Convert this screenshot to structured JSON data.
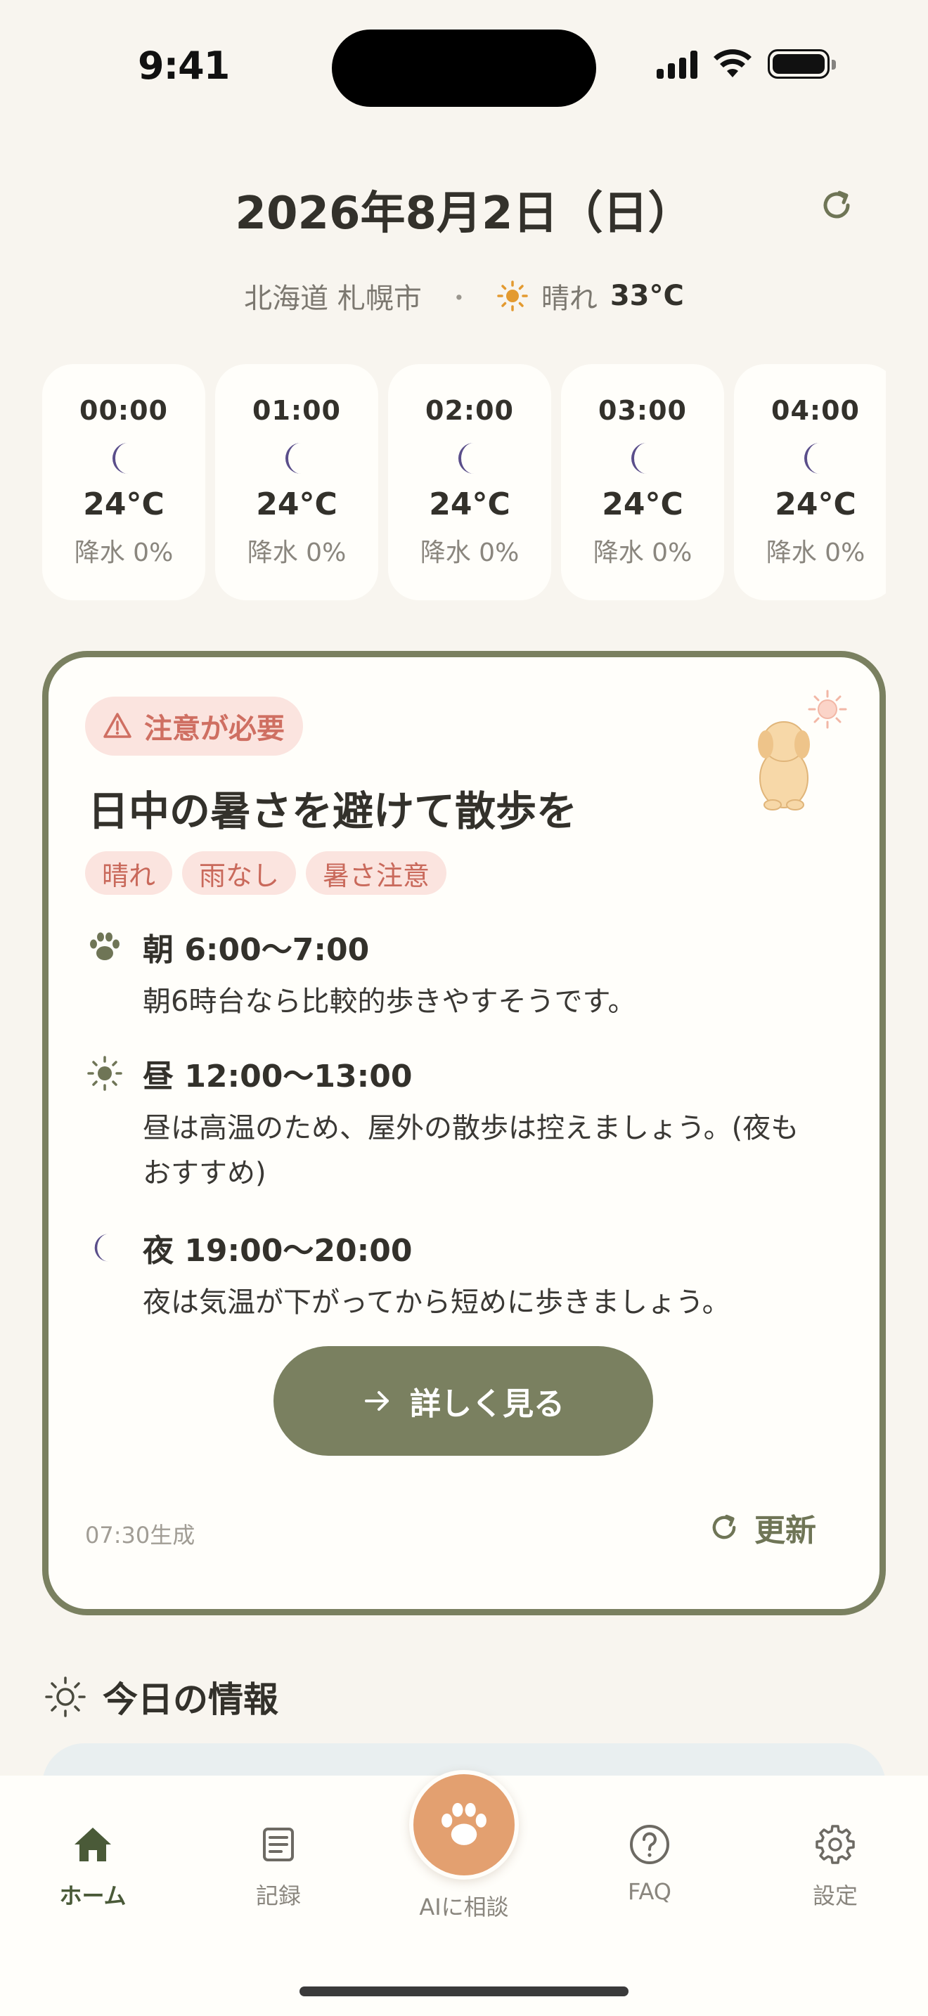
{
  "status_bar": {
    "time": "9:41"
  },
  "header": {
    "date": "2026年8月2日（日）",
    "location": "北海道 札幌市",
    "separator": "・",
    "weather": "晴れ",
    "temperature": "33°C"
  },
  "hourly": [
    {
      "time": "00:00",
      "icon": "moon-icon",
      "temp": "24°C",
      "precip": "降水 0%"
    },
    {
      "time": "01:00",
      "icon": "moon-icon",
      "temp": "24°C",
      "precip": "降水 0%"
    },
    {
      "time": "02:00",
      "icon": "moon-icon",
      "temp": "24°C",
      "precip": "降水 0%"
    },
    {
      "time": "03:00",
      "icon": "moon-icon",
      "temp": "24°C",
      "precip": "降水 0%"
    },
    {
      "time": "04:00",
      "icon": "moon-icon",
      "temp": "24°C",
      "precip": "降水 0%"
    }
  ],
  "advice": {
    "badge": "注意が必要",
    "title": "日中の暑さを避けて散歩を",
    "tags": [
      "晴れ",
      "雨なし",
      "暑さ注意"
    ],
    "slots": [
      {
        "icon": "paw-icon",
        "time": "朝 6:00〜7:00",
        "desc": "朝6時台なら比較的歩きやすそうです。"
      },
      {
        "icon": "sun-icon",
        "time": "昼 12:00〜13:00",
        "desc": "昼は高温のため、屋外の散歩は控えましょう。(夜もおすすめ)"
      },
      {
        "icon": "moon-icon",
        "time": "夜 19:00〜20:00",
        "desc": "夜は気温が下がってから短めに歩きましょう。"
      }
    ],
    "detail_button": "詳しく見る",
    "generated": "07:30生成",
    "update_button": "更新"
  },
  "today": {
    "title": "今日の情報"
  },
  "nav": {
    "home": "ホーム",
    "records": "記録",
    "ai": "AIに相談",
    "faq": "FAQ",
    "settings": "設定"
  },
  "colors": {
    "accent": "#7a8060",
    "warning": "#cf6f62",
    "moon": "#5a4e8a",
    "sun": "#e39a30",
    "ai_button": "#e3a070"
  }
}
